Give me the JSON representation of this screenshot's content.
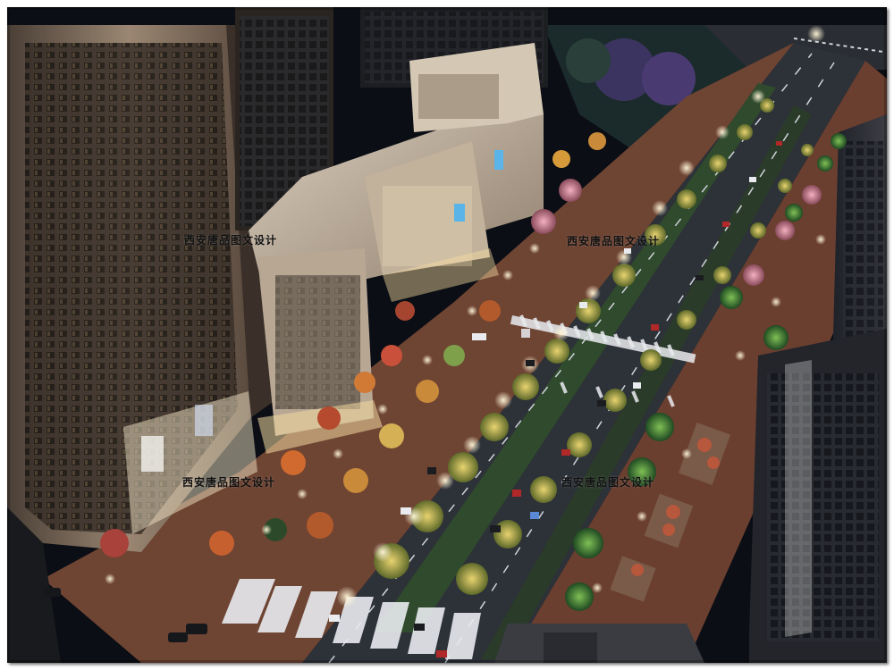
{
  "image": {
    "description_tags": [
      "night-render",
      "aerial-street-view",
      "urban-boulevard"
    ],
    "watermark_text": "西安唐品图文设计",
    "colors": {
      "sky_dark": "#0a0d14",
      "building_lit": "#c9b8a2",
      "road": "#2d3138",
      "sidewalk_warm": "#7a4a35",
      "tree_glow": "#d8c15a",
      "light_white": "#ffffff"
    }
  },
  "watermarks": [
    {
      "text": "西安唐品图文设计"
    },
    {
      "text": "西安唐品图文设计"
    },
    {
      "text": "西安唐品图文设计"
    },
    {
      "text": "西安唐品图文设计"
    }
  ]
}
